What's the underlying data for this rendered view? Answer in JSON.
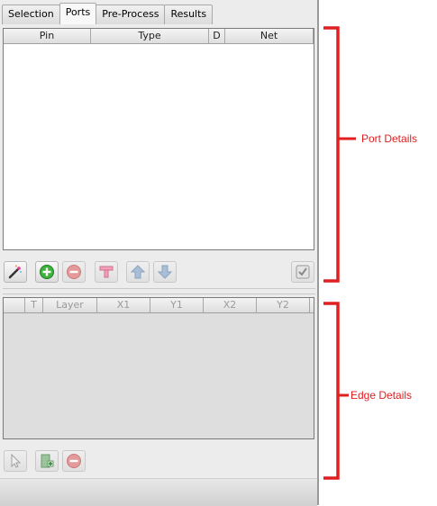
{
  "tabs": [
    {
      "label": "Selection",
      "active": false
    },
    {
      "label": "Ports",
      "active": true
    },
    {
      "label": "Pre-Process",
      "active": false
    },
    {
      "label": "Results",
      "active": false
    }
  ],
  "port_table": {
    "columns": [
      "Pin",
      "Type",
      "D",
      "Net"
    ]
  },
  "port_toolbar": {
    "icons": [
      "magic-wand-icon",
      "add-icon",
      "remove-icon",
      "port-icon",
      "move-up-icon",
      "move-down-icon",
      "validate-icon"
    ]
  },
  "edge_table": {
    "columns": [
      "",
      "T",
      "Layer",
      "X1",
      "Y1",
      "X2",
      "Y2"
    ]
  },
  "edge_toolbar": {
    "icons": [
      "pointer-icon",
      "add-edge-icon",
      "remove-icon"
    ]
  },
  "annotations": {
    "port_details": "Port Details",
    "edge_details": "Edge Details",
    "color": "#e02020"
  }
}
